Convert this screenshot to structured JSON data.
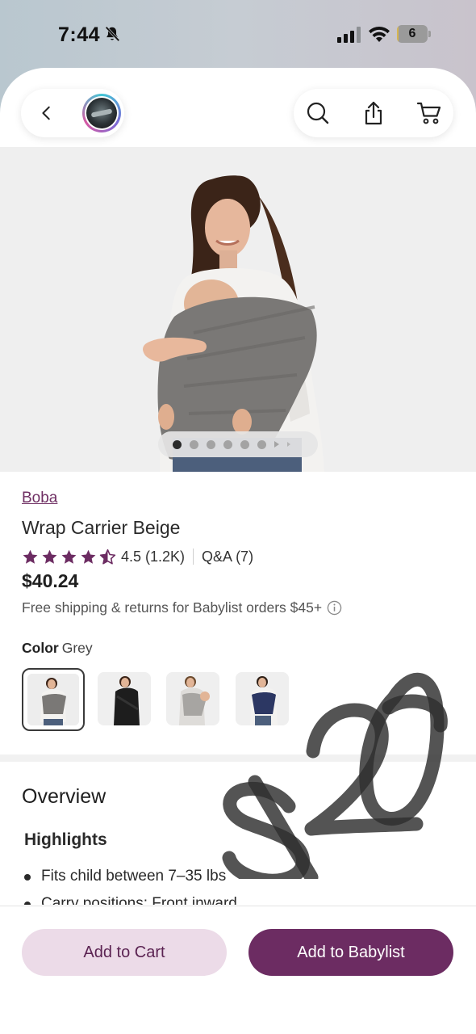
{
  "status_bar": {
    "time": "7:44",
    "battery_level": "6",
    "battery_fraction": 0.06
  },
  "nav": {
    "back_icon": "chevron-left-icon",
    "avatar": "store-avatar",
    "search_icon": "search-icon",
    "share_icon": "share-icon",
    "cart_icon": "cart-icon"
  },
  "gallery": {
    "image_count": 6,
    "active_index": 0
  },
  "product": {
    "brand": "Boba",
    "title": "Wrap Carrier Beige",
    "rating": "4.5 (1.2K)",
    "rating_value": 4.5,
    "qa": "Q&A (7)",
    "price": "$40.24",
    "shipping": "Free shipping & returns for Babylist orders $45+",
    "color_label": "Color",
    "color_value": "Grey"
  },
  "swatches": [
    {
      "name": "Grey",
      "selected": true
    },
    {
      "name": "Black",
      "selected": false
    },
    {
      "name": "Light Grey",
      "selected": false
    },
    {
      "name": "Navy",
      "selected": false
    }
  ],
  "overview": {
    "heading": "Overview",
    "highlights_heading": "Highlights",
    "bullets": [
      "Fits child between 7–35 lbs",
      "Carry positions: Front inward"
    ]
  },
  "actions": {
    "add_to_cart": "Add to Cart",
    "add_to_babylist": "Add to Babylist"
  },
  "colors": {
    "brand_purple": "#6c2c62",
    "link_purple": "#6f2f63",
    "cart_button_bg": "#ecdbe8",
    "star": "#6c2c62"
  },
  "annotation": "$20"
}
